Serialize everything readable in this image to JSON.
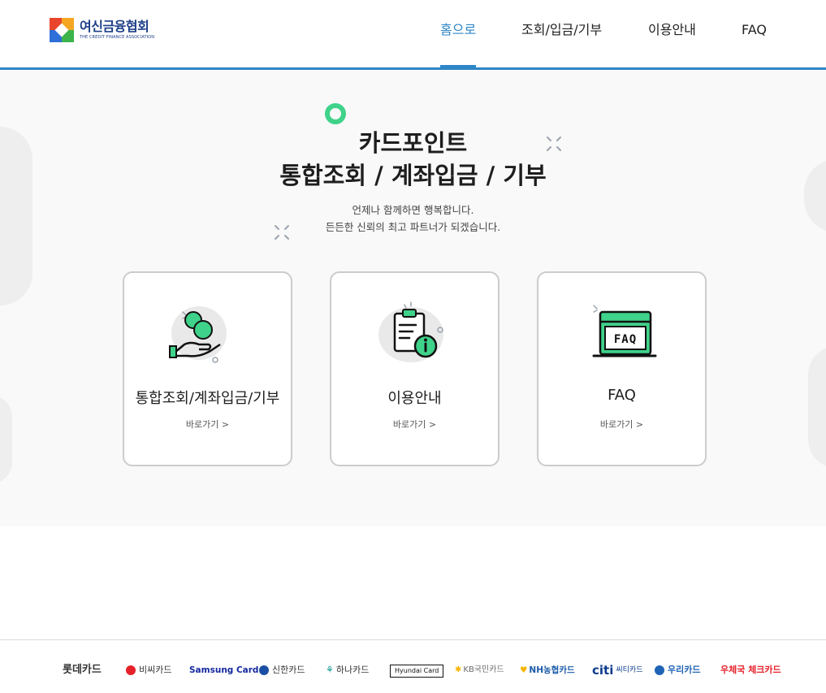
{
  "logo": {
    "ko": "여신금융협회",
    "en": "THE CREDIT FINANCE ASSOCIATION"
  },
  "nav": [
    {
      "label": "홈으로",
      "active": true
    },
    {
      "label": "조회/입금/기부",
      "active": false
    },
    {
      "label": "이용안내",
      "active": false
    },
    {
      "label": "FAQ",
      "active": false
    }
  ],
  "hero": {
    "title_line1": "카드포인트",
    "title_line2": "통합조회 / 계좌입금 / 기부",
    "sub_line1": "언제나 함께하면 행복합니다.",
    "sub_line2": "든든한 신뢰의 최고 파트너가 되겠습니다."
  },
  "cards": [
    {
      "title": "통합조회/계좌입금/기부",
      "link": "바로가기 >",
      "icon": "coin-hand-icon"
    },
    {
      "title": "이용안내",
      "link": "바로가기 >",
      "icon": "clipboard-info-icon"
    },
    {
      "title": "FAQ",
      "link": "바로가기 >",
      "icon": "faq-window-icon"
    }
  ],
  "brands": [
    {
      "label": "롯데카드",
      "color": "#333333"
    },
    {
      "label": "비씨카드",
      "color": "#333333"
    },
    {
      "label": "Samsung Card",
      "color": "#1428a0"
    },
    {
      "label": "신한카드",
      "color": "#333333"
    },
    {
      "label": "하나카드",
      "color": "#333333"
    },
    {
      "label": "Hyundai Card",
      "color": "#111111"
    },
    {
      "label": "KB국민카드",
      "color": "#6b6b6b"
    },
    {
      "label": "NH농협카드",
      "color": "#1a5aa8"
    },
    {
      "label": "citi",
      "color": "#0b3b8c"
    },
    {
      "label": "씨티카드",
      "color": "#0b3b8c"
    },
    {
      "label": "우리카드",
      "color": "#1e63b5"
    },
    {
      "label": "우체국 체크카드",
      "color": "#e6212a"
    }
  ],
  "colors": {
    "accent": "#2f86c8",
    "green": "#3fd28a",
    "hero_bg": "#f9f9f9"
  }
}
